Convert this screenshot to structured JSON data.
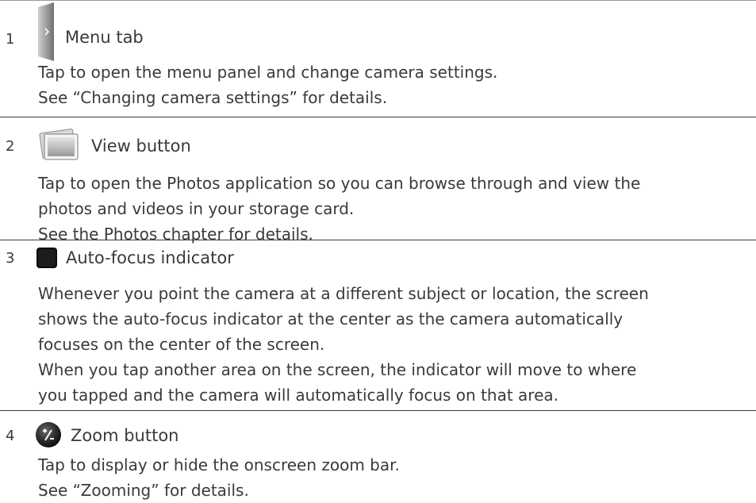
{
  "items": [
    {
      "number": "1",
      "icon": "menu-tab-icon",
      "title": "Menu tab",
      "lines": [
        "Tap to open the menu panel and change camera settings.",
        "See “Changing camera settings” for details."
      ]
    },
    {
      "number": "2",
      "icon": "view-photos-icon",
      "title": "View button",
      "lines": [
        "Tap to open the Photos application so you can browse through and view the",
        "photos and videos in your storage card.",
        "See the Photos chapter for details."
      ]
    },
    {
      "number": "3",
      "icon": "auto-focus-indicator-icon",
      "title": "Auto-focus indicator",
      "lines": [
        "Whenever you point the camera at a different subject or location, the screen",
        "shows the auto-focus indicator at the center as the camera automatically",
        "focuses on the center of the screen.",
        "When you tap another area on the screen, the indicator will move to where",
        "you tapped and the camera will automatically focus on that area."
      ]
    },
    {
      "number": "4",
      "icon": "zoom-icon",
      "title": "Zoom button",
      "lines": [
        "Tap to display or hide the onscreen zoom bar.",
        "See “Zooming” for details."
      ]
    }
  ]
}
